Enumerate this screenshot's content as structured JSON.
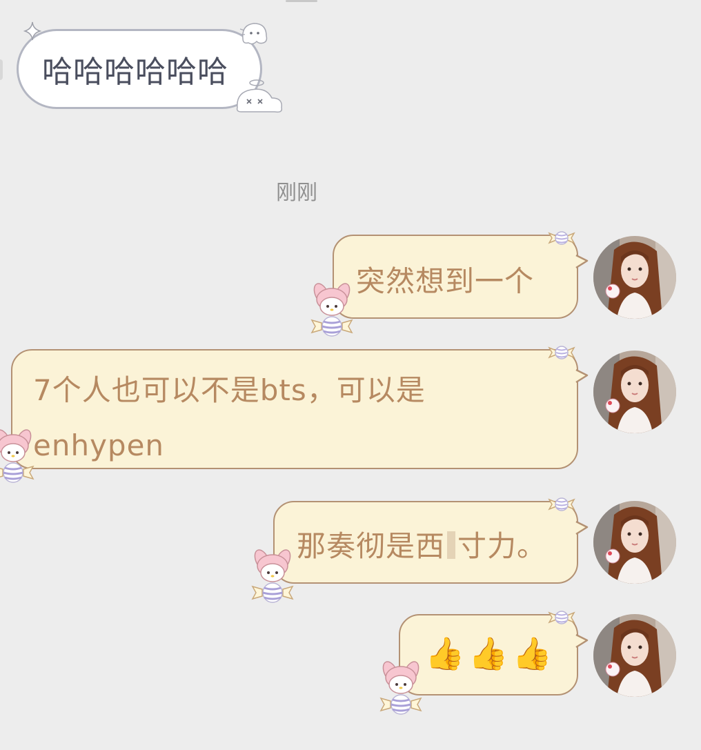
{
  "incoming": {
    "text": "哈哈哈哈哈哈"
  },
  "timestamp": "刚刚",
  "outgoing": [
    {
      "text": "突然想到一个"
    },
    {
      "line1": "7个人也可以不是bts，可以是",
      "line2": "enhypen"
    },
    {
      "before": "那奏彻是西",
      "after": "寸力。"
    },
    {
      "emoji": "👍👍👍"
    }
  ],
  "colors": {
    "background": "#ededed",
    "incoming_bubble": "#ffffff",
    "incoming_border": "#b3b6c2",
    "outgoing_bubble": "#fbf3d7",
    "outgoing_border": "#b39173",
    "outgoing_text": "#b68961"
  },
  "icons": {
    "incoming_decor": [
      "sparkle-icon",
      "ghost-icon",
      "halo-ghost-icon"
    ],
    "outgoing_decor": [
      "candy-icon",
      "my-melody-sticker-icon"
    ],
    "avatar": "user-avatar"
  }
}
